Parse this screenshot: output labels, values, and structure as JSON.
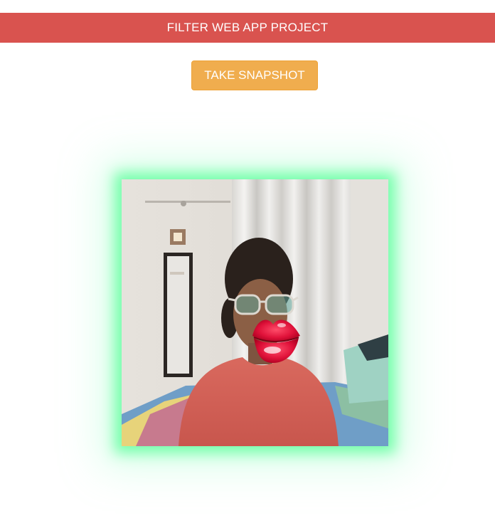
{
  "header": {
    "title": "FILTER WEB APP PROJECT"
  },
  "toolbar": {
    "snapshot_label": "TAKE SNAPSHOT"
  },
  "colors": {
    "header_bg": "#d9534f",
    "button_bg": "#f0ad4e",
    "glow": "#7dffb0"
  },
  "video": {
    "filter": "lips-icon"
  }
}
